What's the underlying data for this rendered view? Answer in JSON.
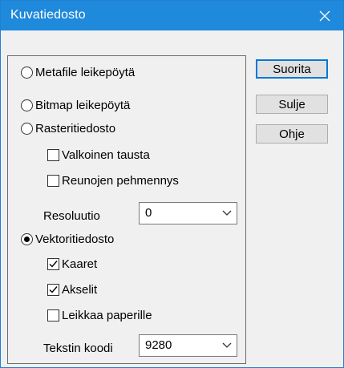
{
  "window": {
    "title": "Kuvatiedosto"
  },
  "options": {
    "metafile": "Metafile leikepöytä",
    "bitmap": "Bitmap leikepöytä",
    "raster": "Rasteritiedosto",
    "white_bg": "Valkoinen tausta",
    "antialias": "Reunojen pehmennys",
    "resolution_label": "Resoluutio",
    "resolution_value": "0",
    "vector": "Vektoritiedosto",
    "arcs": "Kaaret",
    "axes": "Akselit",
    "clip": "Leikkaa paperille",
    "codepage_label": "Tekstin koodi",
    "codepage_value": "9280"
  },
  "state": {
    "selected_format": "Vektoritiedosto",
    "white_bg_checked": false,
    "antialias_checked": false,
    "arcs_checked": true,
    "axes_checked": true,
    "clip_checked": false
  },
  "buttons": {
    "run": "Suorita",
    "close": "Sulje",
    "help": "Ohje"
  },
  "colors": {
    "titlebar": "#1f89db",
    "default_button_border": "#0078d7"
  }
}
